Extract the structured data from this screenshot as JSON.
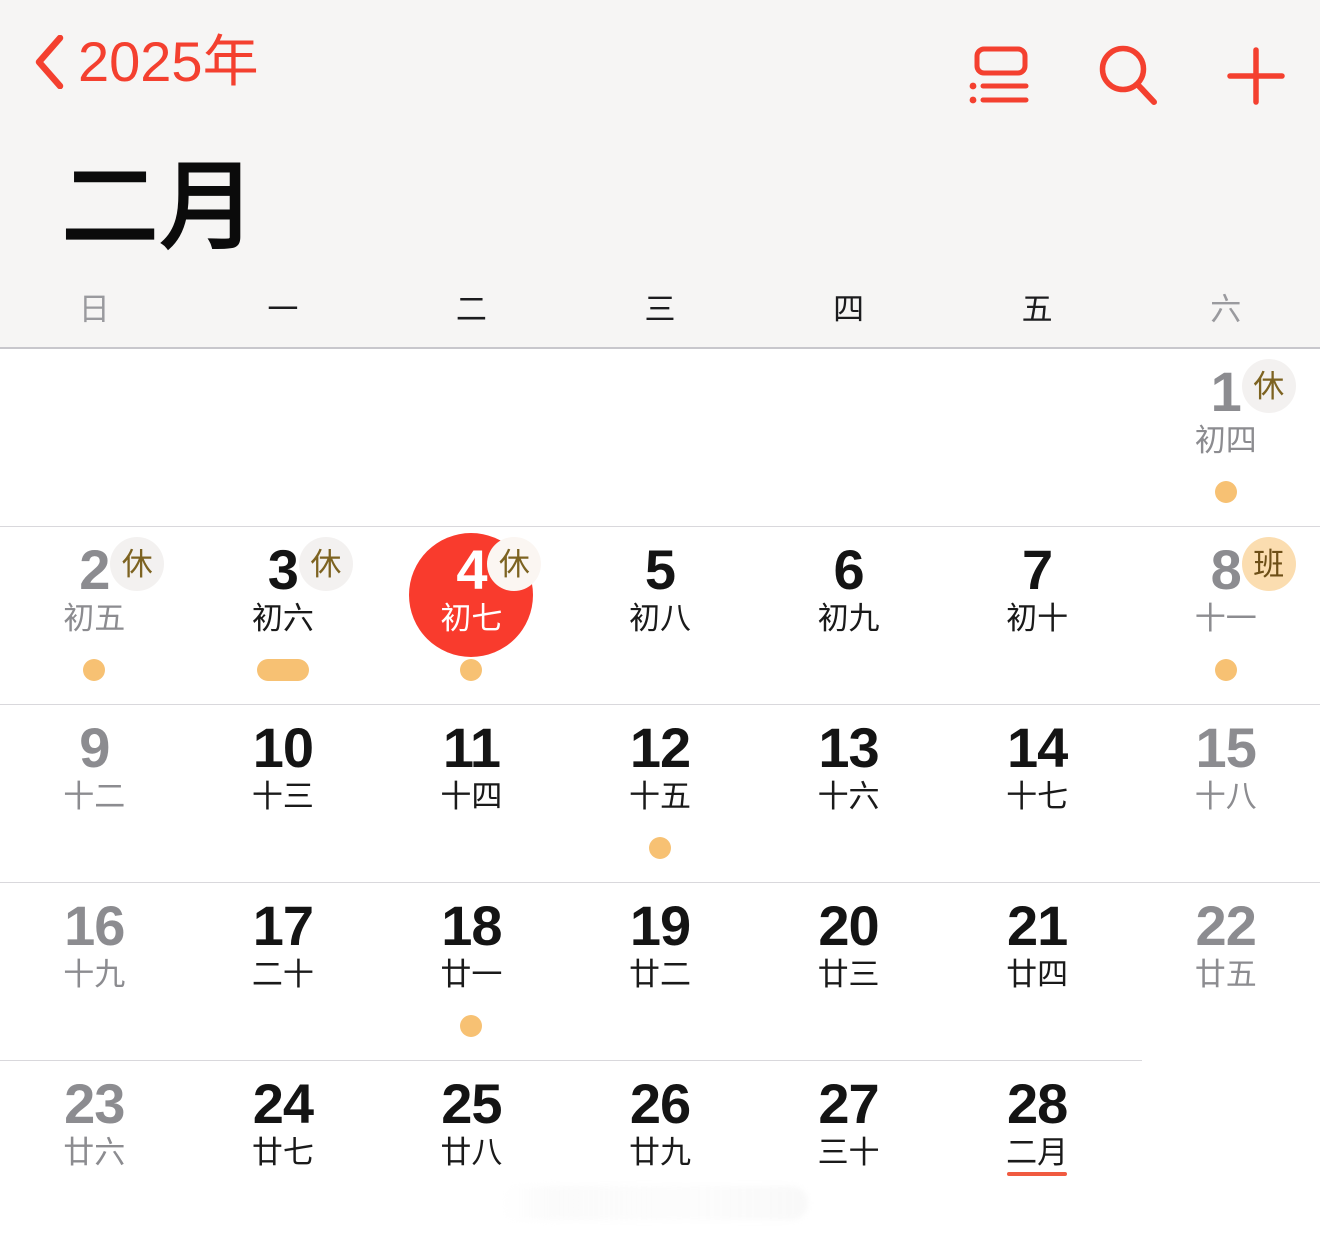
{
  "navbar": {
    "back_label": "2025年",
    "back_icon": "chevron-left-icon",
    "actions": [
      {
        "name": "list-view-icon",
        "label": "列表视图"
      },
      {
        "name": "search-icon",
        "label": "搜索"
      },
      {
        "name": "add-event-icon",
        "label": "添加"
      }
    ]
  },
  "month": {
    "title": "二月"
  },
  "weekdays": [
    {
      "label": "日",
      "weekend": true
    },
    {
      "label": "一",
      "weekend": false
    },
    {
      "label": "二",
      "weekend": false
    },
    {
      "label": "三",
      "weekend": false
    },
    {
      "label": "四",
      "weekend": false
    },
    {
      "label": "五",
      "weekend": false
    },
    {
      "label": "六",
      "weekend": true
    }
  ],
  "colors": {
    "accent_red": "#f4402f",
    "selected_red": "#f93b2d",
    "event_orange": "#f7c173",
    "rest_badge_text": "#7d6321",
    "work_badge_bg": "#fbddb0",
    "muted_text": "#8c8c90",
    "chrome_bg": "#f6f5f4"
  },
  "weeks": [
    {
      "days": [
        {
          "num": "",
          "lunar": "",
          "empty": true
        },
        {
          "num": "",
          "lunar": "",
          "empty": true
        },
        {
          "num": "",
          "lunar": "",
          "empty": true
        },
        {
          "num": "",
          "lunar": "",
          "empty": true
        },
        {
          "num": "",
          "lunar": "",
          "empty": true
        },
        {
          "num": "",
          "lunar": "",
          "empty": true
        },
        {
          "num": "1",
          "lunar": "初四",
          "muted": true,
          "badge": "休",
          "badge_type": "rest",
          "dot": "dot"
        }
      ]
    },
    {
      "days": [
        {
          "num": "2",
          "lunar": "初五",
          "muted": true,
          "badge": "休",
          "badge_type": "rest",
          "dot": "dot"
        },
        {
          "num": "3",
          "lunar": "初六",
          "muted": false,
          "badge": "休",
          "badge_type": "rest",
          "dot": "pill"
        },
        {
          "num": "4",
          "lunar": "初七",
          "muted": false,
          "selected": true,
          "badge": "休",
          "badge_type": "rest",
          "dot": "dot"
        },
        {
          "num": "5",
          "lunar": "初八",
          "muted": false
        },
        {
          "num": "6",
          "lunar": "初九",
          "muted": false
        },
        {
          "num": "7",
          "lunar": "初十",
          "muted": false
        },
        {
          "num": "8",
          "lunar": "十一",
          "muted": true,
          "badge": "班",
          "badge_type": "work",
          "dot": "dot"
        }
      ]
    },
    {
      "days": [
        {
          "num": "9",
          "lunar": "十二",
          "muted": true
        },
        {
          "num": "10",
          "lunar": "十三",
          "muted": false
        },
        {
          "num": "11",
          "lunar": "十四",
          "muted": false
        },
        {
          "num": "12",
          "lunar": "十五",
          "muted": false,
          "dot": "dot"
        },
        {
          "num": "13",
          "lunar": "十六",
          "muted": false
        },
        {
          "num": "14",
          "lunar": "十七",
          "muted": false
        },
        {
          "num": "15",
          "lunar": "十八",
          "muted": true
        }
      ]
    },
    {
      "days": [
        {
          "num": "16",
          "lunar": "十九",
          "muted": true
        },
        {
          "num": "17",
          "lunar": "二十",
          "muted": false
        },
        {
          "num": "18",
          "lunar": "廿一",
          "muted": false,
          "dot": "dot"
        },
        {
          "num": "19",
          "lunar": "廿二",
          "muted": false
        },
        {
          "num": "20",
          "lunar": "廿三",
          "muted": false
        },
        {
          "num": "21",
          "lunar": "廿四",
          "muted": false
        },
        {
          "num": "22",
          "lunar": "廿五",
          "muted": true
        }
      ],
      "separator": "partial"
    },
    {
      "days": [
        {
          "num": "23",
          "lunar": "廿六",
          "muted": true
        },
        {
          "num": "24",
          "lunar": "廿七",
          "muted": false
        },
        {
          "num": "25",
          "lunar": "廿八",
          "muted": false
        },
        {
          "num": "26",
          "lunar": "廿九",
          "muted": false
        },
        {
          "num": "27",
          "lunar": "三十",
          "muted": false
        },
        {
          "num": "28",
          "lunar": "二月",
          "muted": false,
          "lunar_underline": true
        },
        {
          "num": "",
          "lunar": "",
          "empty": true
        }
      ],
      "separator": "none"
    }
  ]
}
